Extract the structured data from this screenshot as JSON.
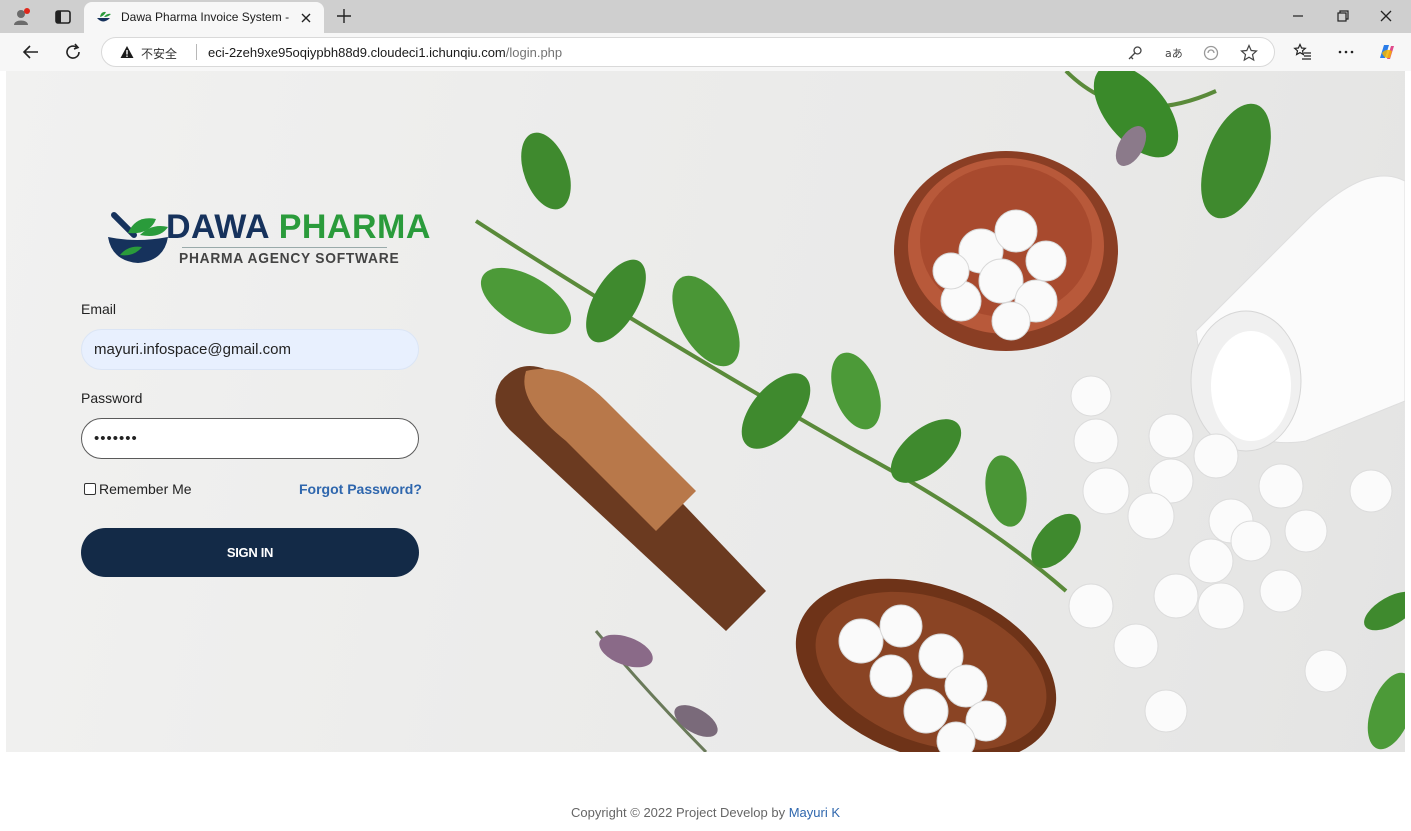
{
  "browser": {
    "tab_title": "Dawa Pharma Invoice System - M",
    "insecure_label": "不安全",
    "url_host": "eci-2zeh9xe95oqiypbh88d9.cloudeci1.ichunqiu.com",
    "url_path": "/login.php"
  },
  "brand": {
    "name_part1": "DAWA",
    "name_part2": "PHARMA",
    "tagline": "PHARMA AGENCY SOFTWARE",
    "color_primary": "#16325c",
    "color_accent": "#2a9b3b"
  },
  "login": {
    "email_label": "Email",
    "email_value": "mayuri.infospace@gmail.com",
    "password_label": "Password",
    "password_value": "•••••••",
    "remember_label": "Remember Me",
    "forgot_label": "Forgot Password?",
    "signin_label": "SIGN IN",
    "button_color": "#132a47"
  },
  "footer": {
    "copyright_text": "Copyright © 2022 Project Develop by ",
    "author": "Mayuri K"
  }
}
